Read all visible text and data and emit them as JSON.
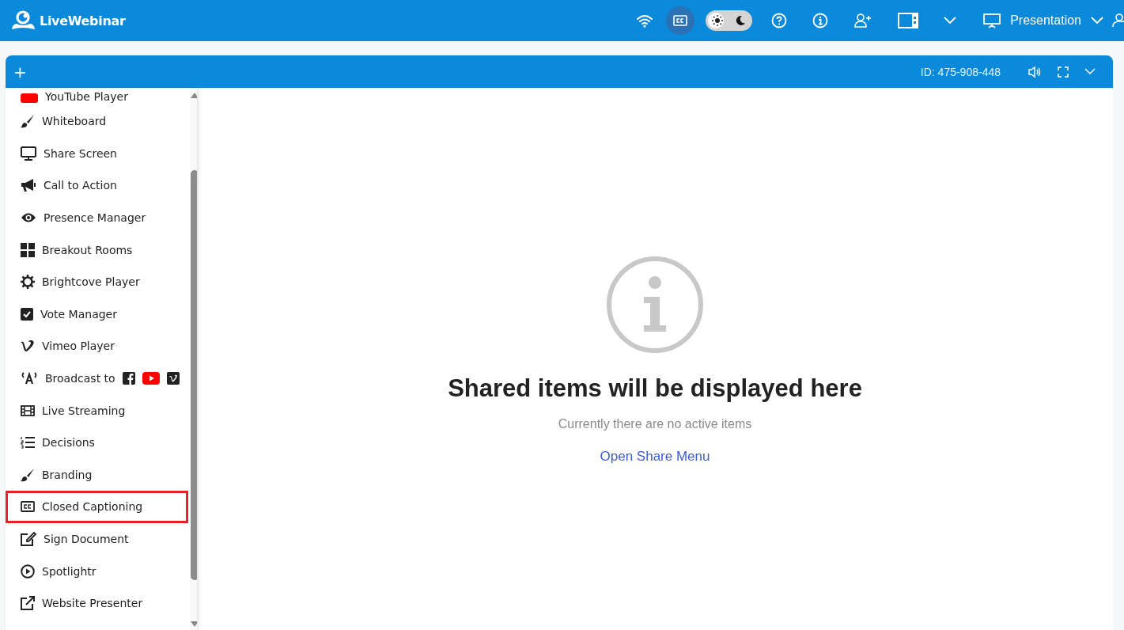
{
  "topbar": {
    "logo": "LiveWebinar",
    "captions_on": true,
    "theme_dark": false,
    "layout_menu": "Presentation"
  },
  "panel": {
    "add": "+",
    "meeting_id": "ID: 475-908-448"
  },
  "share_menu": [
    {
      "label": "YouTube Player",
      "highlighted": false
    },
    {
      "label": "Whiteboard",
      "highlighted": false
    },
    {
      "label": "Share Screen",
      "highlighted": false
    },
    {
      "label": "Call to Action",
      "highlighted": false
    },
    {
      "label": "Presence Manager",
      "highlighted": false
    },
    {
      "label": "Breakout Rooms",
      "highlighted": false
    },
    {
      "label": "Brightcove Player",
      "highlighted": false
    },
    {
      "label": "Vote Manager",
      "highlighted": false
    },
    {
      "label": "Vimeo Player",
      "highlighted": false
    },
    {
      "label": "Broadcast to",
      "highlighted": false
    },
    {
      "label": "Live Streaming",
      "highlighted": false
    },
    {
      "label": "Decisions",
      "highlighted": false
    },
    {
      "label": "Branding",
      "highlighted": false
    },
    {
      "label": "Closed Captioning",
      "highlighted": true
    },
    {
      "label": "Sign Document",
      "highlighted": false
    },
    {
      "label": "Spotlightr",
      "highlighted": false
    },
    {
      "label": "Website Presenter",
      "highlighted": false
    }
  ],
  "empty_state": {
    "title": "Shared items will be displayed here",
    "subtitle": "Currently there are no active items",
    "link": "Open Share Menu"
  }
}
